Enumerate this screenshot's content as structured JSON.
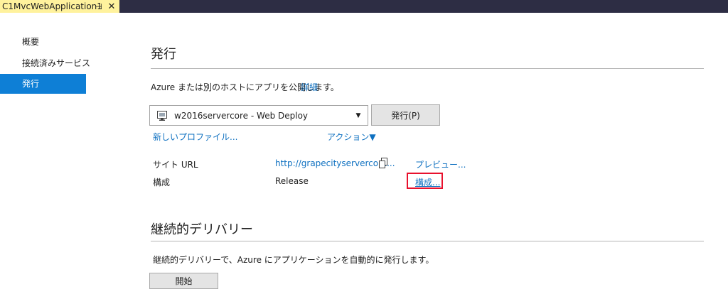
{
  "tab": {
    "title": "C1MvcWebApplication1",
    "pin_icon": "pin-icon",
    "close_icon": "close-icon"
  },
  "nav": {
    "items": [
      {
        "label": "概要"
      },
      {
        "label": "接続済みサービス"
      },
      {
        "label": "発行",
        "selected": true
      }
    ]
  },
  "publish": {
    "title": "発行",
    "description": "Azure または別のホストにアプリを公開します。",
    "details_link": "詳細",
    "profile_value": "w2016servercore - Web Deploy",
    "publish_button": "発行(P)",
    "new_profile_link": "新しいプロファイル...",
    "actions_link": "アクション▼",
    "site_url_label": "サイト URL",
    "site_url_value": "http://grapecityservercore...",
    "preview_link": "プレビュー...",
    "config_label": "構成",
    "config_value": "Release",
    "config_link": "構成..."
  },
  "cd": {
    "title": "継続的デリバリー",
    "description": "継続的デリバリーで、Azure にアプリケーションを自動的に発行します。",
    "start_button": "開始"
  },
  "colors": {
    "accent": "#0e7fd6",
    "link": "#0e70c0",
    "tab_highlight": "#fff29d",
    "topbar": "#2d2d44",
    "highlight_border": "#e8112d"
  }
}
